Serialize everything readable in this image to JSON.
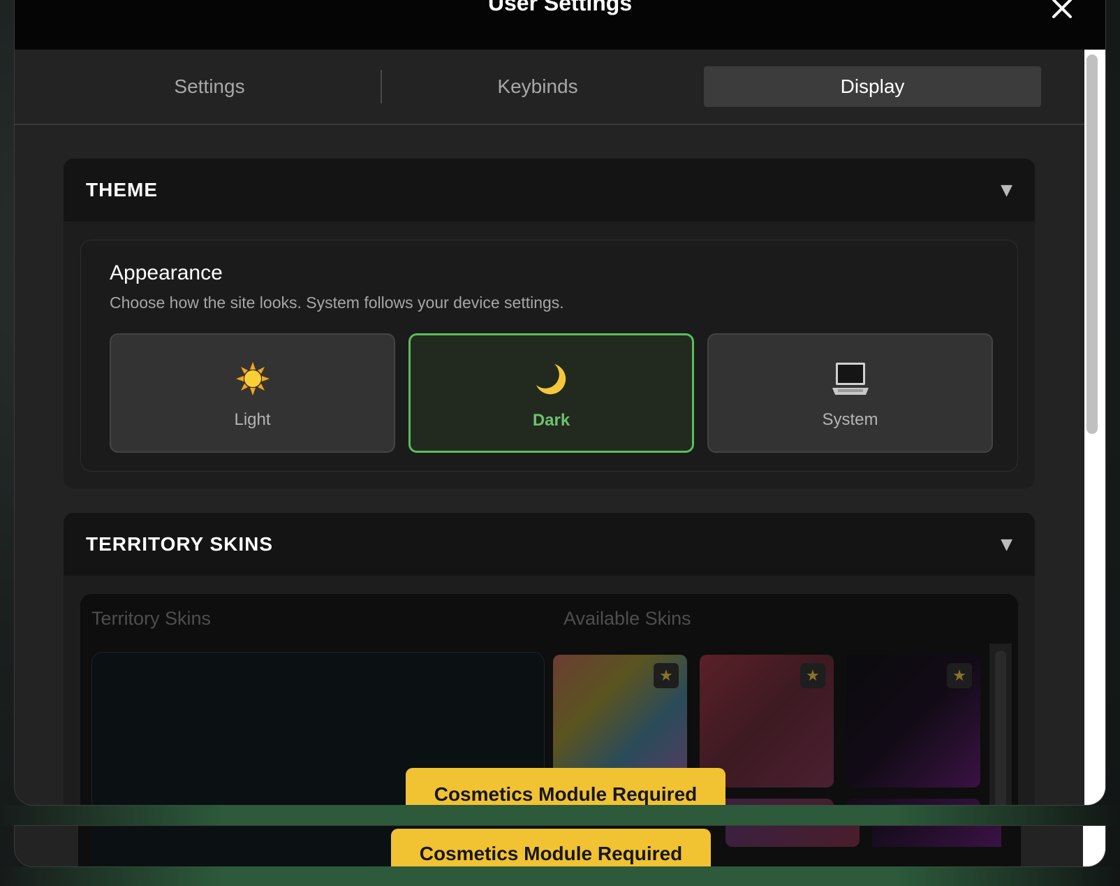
{
  "header": {
    "title": "User Settings"
  },
  "tabs": [
    {
      "label": "Settings",
      "active": false
    },
    {
      "label": "Keybinds",
      "active": false
    },
    {
      "label": "Display",
      "active": true
    }
  ],
  "theme_section": {
    "title": "THEME",
    "card": {
      "title": "Appearance",
      "subtitle": "Choose how the site looks. System follows your device settings.",
      "options": [
        {
          "label": "Light",
          "icon": "sun-icon",
          "selected": false
        },
        {
          "label": "Dark",
          "icon": "moon-icon",
          "selected": true
        },
        {
          "label": "System",
          "icon": "laptop-icon",
          "selected": false
        }
      ]
    }
  },
  "skins_section": {
    "title": "TERRITORY SKINS",
    "left_label": "Territory Skins",
    "right_label": "Available Skins",
    "banner": "Cosmetics Module Required"
  },
  "colors": {
    "accent": "#5cbd5c",
    "banner": "#f1c232"
  }
}
